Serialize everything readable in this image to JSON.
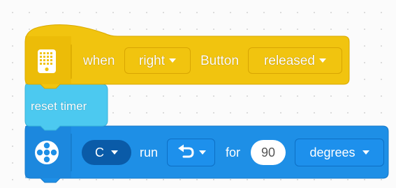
{
  "hat_block": {
    "icon": "hub-button-icon",
    "when_label": "when",
    "direction_value": "right",
    "button_label": "Button",
    "action_value": "released",
    "color": "#f1c40f"
  },
  "timer_block": {
    "label": "reset timer",
    "color": "#4cc9f0"
  },
  "motor_block": {
    "icon": "motor-icon",
    "port_value": "C",
    "run_label": "run",
    "direction_icon": "counterclockwise-arrow-icon",
    "for_label": "for",
    "amount_value": "90",
    "unit_value": "degrees",
    "color": "#1e8fe6"
  }
}
